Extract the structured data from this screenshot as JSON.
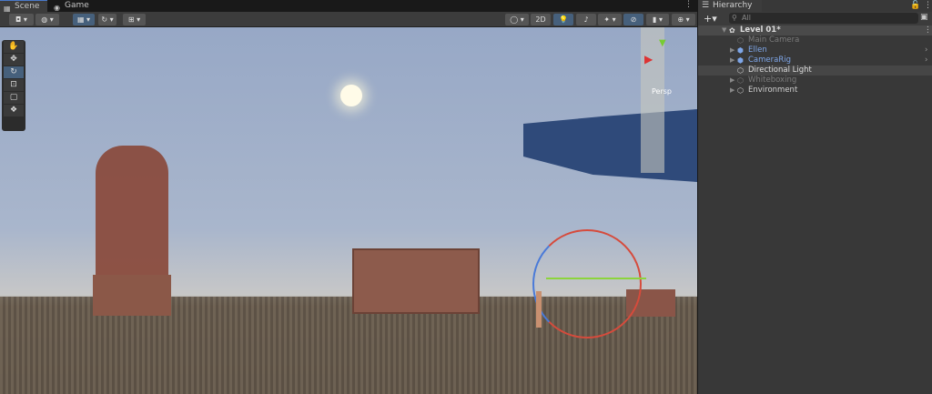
{
  "tabs": [
    {
      "label": "Scene",
      "icon": "grid-icon"
    },
    {
      "label": "Game",
      "icon": "gamepad-icon"
    }
  ],
  "toolbar": {
    "mode_2d": "2D"
  },
  "scene": {
    "projection_label": "Persp"
  },
  "hierarchy": {
    "title": "Hierarchy",
    "search_placeholder": "All",
    "scene_name": "Level 01*",
    "items": [
      {
        "label": "Main Camera",
        "state": "disabled"
      },
      {
        "label": "Ellen",
        "state": "prefab"
      },
      {
        "label": "CameraRig",
        "state": "prefab"
      },
      {
        "label": "Directional Light",
        "state": "selected"
      },
      {
        "label": "Whiteboxing",
        "state": "disabled"
      },
      {
        "label": "Environment",
        "state": "normal"
      }
    ]
  }
}
